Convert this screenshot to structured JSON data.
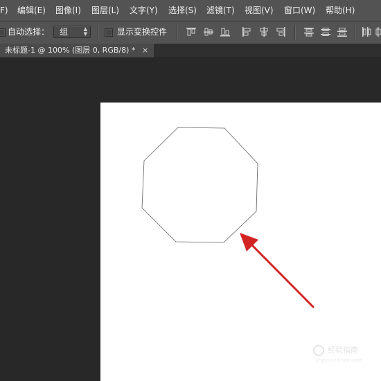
{
  "menubar": {
    "items": [
      {
        "label": "F)"
      },
      {
        "label": "编辑(E)"
      },
      {
        "label": "图像(I)"
      },
      {
        "label": "图层(L)"
      },
      {
        "label": "文字(Y)"
      },
      {
        "label": "选择(S)"
      },
      {
        "label": "滤镜(T)"
      },
      {
        "label": "视图(V)"
      },
      {
        "label": "窗口(W)"
      },
      {
        "label": "帮助(H)"
      }
    ]
  },
  "options": {
    "auto_select_label": "自动选择：",
    "auto_select_checked": false,
    "auto_select_value": "组",
    "show_transform_label": "显示变换控件",
    "show_transform_checked": false
  },
  "document": {
    "tab_title": "未标题-1 @ 100% (图层 0, RGB/8) *",
    "close_glyph": "×"
  },
  "canvas": {
    "background": "#ffffff",
    "shape_name": "octagon-path",
    "annotation_color": "#d32424"
  },
  "watermark": {
    "text": "经验指南",
    "subtext": "jingyanzhinan.com"
  },
  "colors": {
    "menubar_bg": "#535353",
    "workspace_bg": "#282828",
    "tab_bg": "#4a4a4a"
  }
}
